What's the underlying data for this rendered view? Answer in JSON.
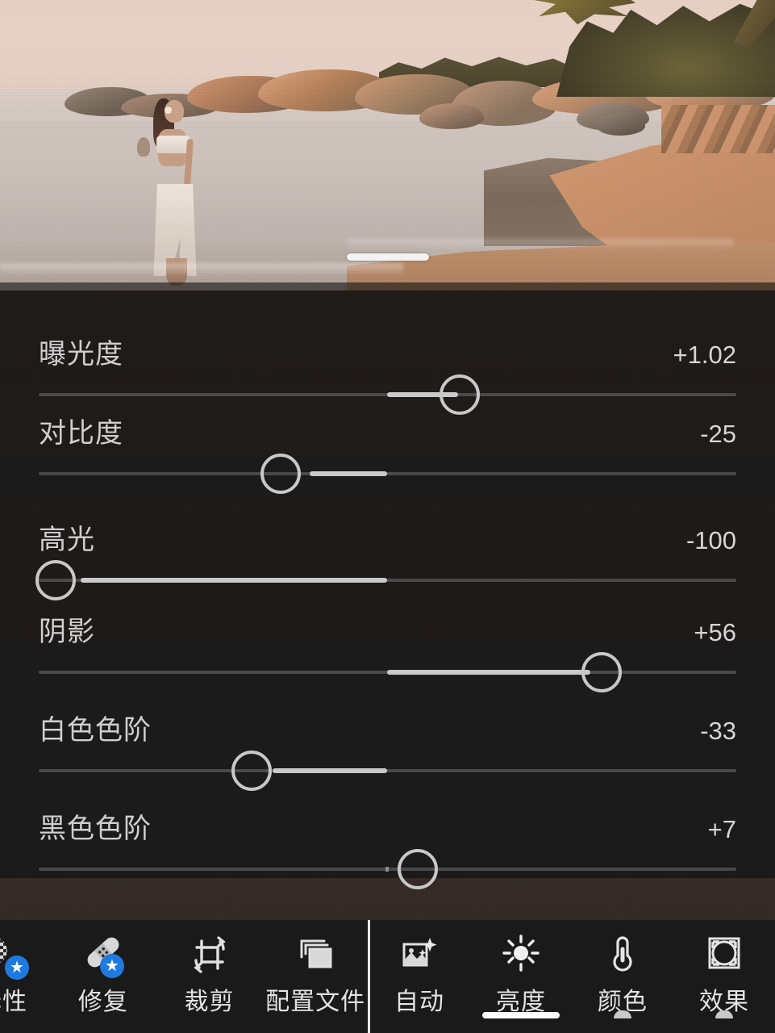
{
  "app": {
    "name": "photo-editor",
    "theme_bg": "#1a1a1a",
    "accent": "#1f7ae0",
    "slider_thumb_color": "#c8c8c8",
    "slider_track_color": "#4a4a4a"
  },
  "photo": {
    "description": "beach-sunset-woman-white-sarong",
    "drag_handle": "photo-drag-handle"
  },
  "panel": {
    "section": "亮度",
    "sliders": [
      {
        "label": "曝光度",
        "value": "+1.02",
        "num": 1.02,
        "min": -5,
        "max": 5,
        "pct": 60.2
      },
      {
        "label": "对比度",
        "value": "-25",
        "num": -25,
        "min": -100,
        "max": 100,
        "pct": 35.0
      },
      {
        "label": "高光",
        "value": "-100",
        "num": -100,
        "min": -100,
        "max": 100,
        "pct": 2.3
      },
      {
        "label": "阴影",
        "value": "+56",
        "num": 56,
        "min": -100,
        "max": 100,
        "pct": 80.7
      },
      {
        "label": "白色色阶",
        "value": "-33",
        "num": -33,
        "min": -100,
        "max": 100,
        "pct": 30.6
      },
      {
        "label": "黑色色阶",
        "value": "+7",
        "num": 7,
        "min": -100,
        "max": 100,
        "pct": 54.6
      }
    ]
  },
  "toolbar": {
    "left_items": [
      {
        "label": "择性",
        "icon": "selective-icon",
        "badge": "★",
        "truncated": true
      },
      {
        "label": "修复",
        "icon": "heal-icon",
        "badge": "★",
        "truncated": false
      },
      {
        "label": "裁剪",
        "icon": "crop-icon",
        "badge": "",
        "truncated": false
      },
      {
        "label": "配置文件",
        "icon": "profiles-icon",
        "badge": "",
        "truncated": false
      }
    ],
    "right_items": [
      {
        "label": "自动",
        "icon": "auto-icon",
        "state": "idle"
      },
      {
        "label": "亮度",
        "icon": "light-sun-icon",
        "state": "active"
      },
      {
        "label": "颜色",
        "icon": "color-thermometer-icon",
        "state": "edited"
      },
      {
        "label": "效果",
        "icon": "effects-frame-icon",
        "state": "edited"
      }
    ]
  }
}
